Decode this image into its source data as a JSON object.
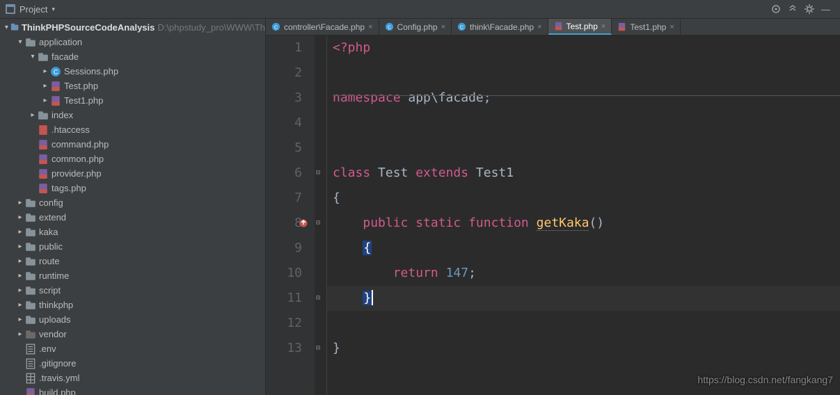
{
  "toolbar": {
    "project_label": "Project"
  },
  "project": {
    "root": {
      "name": "ThinkPHPSourceCodeAnalysis",
      "path": "D:\\phpstudy_pro\\WWW\\Th"
    },
    "tree": [
      {
        "depth": 1,
        "arrow": "down",
        "icon": "folder",
        "label": "application"
      },
      {
        "depth": 2,
        "arrow": "down",
        "icon": "folder",
        "label": "facade"
      },
      {
        "depth": 3,
        "arrow": "right",
        "icon": "php-c",
        "label": "Sessions.php"
      },
      {
        "depth": 3,
        "arrow": "right",
        "icon": "php-file",
        "label": "Test.php"
      },
      {
        "depth": 3,
        "arrow": "right",
        "icon": "php-file",
        "label": "Test1.php"
      },
      {
        "depth": 2,
        "arrow": "right",
        "icon": "folder",
        "label": "index"
      },
      {
        "depth": 2,
        "arrow": "",
        "icon": "file-red",
        "label": ".htaccess"
      },
      {
        "depth": 2,
        "arrow": "",
        "icon": "php-file",
        "label": "command.php"
      },
      {
        "depth": 2,
        "arrow": "",
        "icon": "php-file",
        "label": "common.php"
      },
      {
        "depth": 2,
        "arrow": "",
        "icon": "php-file",
        "label": "provider.php"
      },
      {
        "depth": 2,
        "arrow": "",
        "icon": "php-file",
        "label": "tags.php"
      },
      {
        "depth": 1,
        "arrow": "right",
        "icon": "folder",
        "label": "config"
      },
      {
        "depth": 1,
        "arrow": "right",
        "icon": "folder",
        "label": "extend"
      },
      {
        "depth": 1,
        "arrow": "right",
        "icon": "folder",
        "label": "kaka"
      },
      {
        "depth": 1,
        "arrow": "right",
        "icon": "folder",
        "label": "public"
      },
      {
        "depth": 1,
        "arrow": "right",
        "icon": "folder",
        "label": "route"
      },
      {
        "depth": 1,
        "arrow": "right",
        "icon": "folder",
        "label": "runtime"
      },
      {
        "depth": 1,
        "arrow": "right",
        "icon": "folder",
        "label": "script"
      },
      {
        "depth": 1,
        "arrow": "right",
        "icon": "folder",
        "label": "thinkphp"
      },
      {
        "depth": 1,
        "arrow": "right",
        "icon": "folder",
        "label": "uploads"
      },
      {
        "depth": 1,
        "arrow": "right",
        "icon": "folder-grey",
        "label": "vendor"
      },
      {
        "depth": 1,
        "arrow": "",
        "icon": "file",
        "label": ".env"
      },
      {
        "depth": 1,
        "arrow": "",
        "icon": "file",
        "label": ".gitignore"
      },
      {
        "depth": 1,
        "arrow": "",
        "icon": "file-grid",
        "label": ".travis.yml"
      },
      {
        "depth": 1,
        "arrow": "",
        "icon": "php-file",
        "label": "build.php"
      }
    ]
  },
  "tabs": [
    {
      "icon": "php-c",
      "label": "controller\\Facade.php",
      "active": false
    },
    {
      "icon": "php-c",
      "label": "Config.php",
      "active": false
    },
    {
      "icon": "php-c",
      "label": "think\\Facade.php",
      "active": false
    },
    {
      "icon": "php-file",
      "label": "Test.php",
      "active": true
    },
    {
      "icon": "php-file",
      "label": "Test1.php",
      "active": false
    }
  ],
  "editor": {
    "lines": [
      "1",
      "2",
      "3",
      "4",
      "5",
      "6",
      "7",
      "8",
      "9",
      "10",
      "11",
      "12",
      "13"
    ],
    "code": {
      "l1_a": "<?php",
      "l3_a": "namespace ",
      "l3_b": "app\\facade",
      "l3_c": ";",
      "l6_a": "class ",
      "l6_b": "Test ",
      "l6_c": "extends ",
      "l6_d": "Test1",
      "l7_a": "{",
      "l8_a": "public static function ",
      "l8_b": "getKaka",
      "l8_c": "()",
      "l9_a": "{",
      "l10_a": "return ",
      "l10_b": "147",
      "l10_c": ";",
      "l11_a": "}",
      "l13_a": "}"
    }
  },
  "watermark": "https://blog.csdn.net/fangkang7"
}
